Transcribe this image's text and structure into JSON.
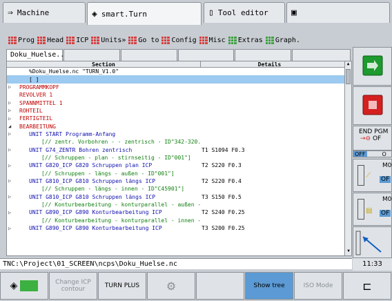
{
  "tabs": [
    {
      "label": "Machine",
      "icon": "arrow-right-icon"
    },
    {
      "label": "smart.Turn",
      "icon": "diamond-arrow-icon"
    },
    {
      "label": "Tool editor",
      "icon": "document-icon"
    },
    {
      "label": "",
      "icon": "save-icon"
    }
  ],
  "menu": [
    "Prog",
    "Head",
    "ICP",
    "Units»",
    "Go to",
    "Config",
    "Misc",
    "Extras",
    "Graph."
  ],
  "doctabs": [
    "Doku_Huelse...",
    "",
    "",
    "",
    "",
    ""
  ],
  "table": {
    "headers": [
      "Section",
      "Details"
    ],
    "rows": [
      {
        "exp": "",
        "section": "%Doku_Huelse.nc  \"TURN_V1.0\"",
        "details": "",
        "color": "black",
        "indent": 1,
        "selected": false
      },
      {
        "exp": "",
        "section": "[ ]",
        "details": "",
        "color": "black",
        "indent": 1,
        "selected": true
      },
      {
        "exp": "▷",
        "section": "PROGRAMMKOPF",
        "details": "",
        "color": "red",
        "indent": 0,
        "selected": false
      },
      {
        "exp": "",
        "section": "REVOLVER 1",
        "details": "",
        "color": "red",
        "indent": 0,
        "selected": false
      },
      {
        "exp": "▷",
        "section": "SPANNMITTEL 1",
        "details": "",
        "color": "red",
        "indent": 0,
        "selected": false
      },
      {
        "exp": "▷",
        "section": "ROHTEIL",
        "details": "",
        "color": "red",
        "indent": 0,
        "selected": false
      },
      {
        "exp": "▷",
        "section": "FERTIGTEIL",
        "details": "",
        "color": "red",
        "indent": 0,
        "selected": false
      },
      {
        "exp": "◢",
        "section": "BEARBEITUNG",
        "details": "",
        "color": "red",
        "indent": 0,
        "selected": false
      },
      {
        "exp": "▷",
        "section": "UNIT START     Programm-Anfang",
        "details": "",
        "color": "blue",
        "indent": 1,
        "selected": false
      },
      {
        "exp": "",
        "section": "[// zentr. Vorbohren -  - zentrisch - ID\"342-320...",
        "details": "",
        "color": "green",
        "indent": 2,
        "selected": false
      },
      {
        "exp": "▷",
        "section": "UNIT G74_ZENTR Bohren zentrisch",
        "details": "T1 S1094 F0.3",
        "color": "blue",
        "indent": 1,
        "selected": false
      },
      {
        "exp": "",
        "section": "[// Schruppen - plan - stirnseitig - ID\"001\"]",
        "details": "",
        "color": "green",
        "indent": 2,
        "selected": false
      },
      {
        "exp": "▷",
        "section": "UNIT G820_ICP  G820 Schruppen plan ICP",
        "details": "T2 S220 F0.3",
        "color": "blue",
        "indent": 1,
        "selected": false
      },
      {
        "exp": "",
        "section": "[// Schruppen - längs - außen - ID\"001\"]",
        "details": "",
        "color": "green",
        "indent": 2,
        "selected": false
      },
      {
        "exp": "▷",
        "section": "UNIT G810_ICP  G810 Schruppen längs ICP",
        "details": "T2 S220 F0.4",
        "color": "blue",
        "indent": 1,
        "selected": false
      },
      {
        "exp": "",
        "section": "[// Schruppen - längs - innen - ID\"C45901\"]",
        "details": "",
        "color": "green",
        "indent": 2,
        "selected": false
      },
      {
        "exp": "▷",
        "section": "UNIT G810_ICP  G810 Schruppen längs ICP",
        "details": "T3 S150 F0.5",
        "color": "blue",
        "indent": 1,
        "selected": false
      },
      {
        "exp": "",
        "section": "[// Konturbearbeitung - konturparallel - außen - ...",
        "details": "",
        "color": "green",
        "indent": 2,
        "selected": false
      },
      {
        "exp": "▷",
        "section": "UNIT G890_ICP  G890 Konturbearbeitung ICP",
        "details": "T2 S240 F0.25",
        "color": "blue",
        "indent": 1,
        "selected": false
      },
      {
        "exp": "",
        "section": "[// Konturbearbeitung - konturparallel - innen - ...",
        "details": "",
        "color": "green",
        "indent": 2,
        "selected": false
      },
      {
        "exp": "▷",
        "section": "UNIT G890_ICP  G890 Konturbearbeitung ICP",
        "details": "T3 S200 F0.25",
        "color": "blue",
        "indent": 1,
        "selected": false
      }
    ]
  },
  "status_path": "TNC:\\Project\\01_SCREEN\\ncps\\Doku_Huelse.nc",
  "clock": "11:33",
  "softkeys": [
    {
      "label": "",
      "icon": "diamond-arrow-icon",
      "state": "normal"
    },
    {
      "label": "Change ICP contour",
      "state": "disabled"
    },
    {
      "label": "TURN PLUS",
      "state": "normal"
    },
    {
      "label": "",
      "icon": "tool-icon",
      "state": "disabled"
    },
    {
      "label": "",
      "state": "normal"
    },
    {
      "label": "Show tree",
      "state": "on"
    },
    {
      "label": "ISO Mode",
      "state": "disabled"
    },
    {
      "label": "",
      "icon": "contour-icon",
      "state": "normal"
    }
  ],
  "vkeys": {
    "start_icon": "nc-start-icon",
    "stop_icon": "nc-stop-icon",
    "end_pgm": "END PGM",
    "end_pgm_off_on": "OF",
    "off_label": "OFF",
    "on_label": "O",
    "m1": "M0",
    "m1_value": "OF",
    "m2": "M0",
    "m2_value": "OF"
  }
}
